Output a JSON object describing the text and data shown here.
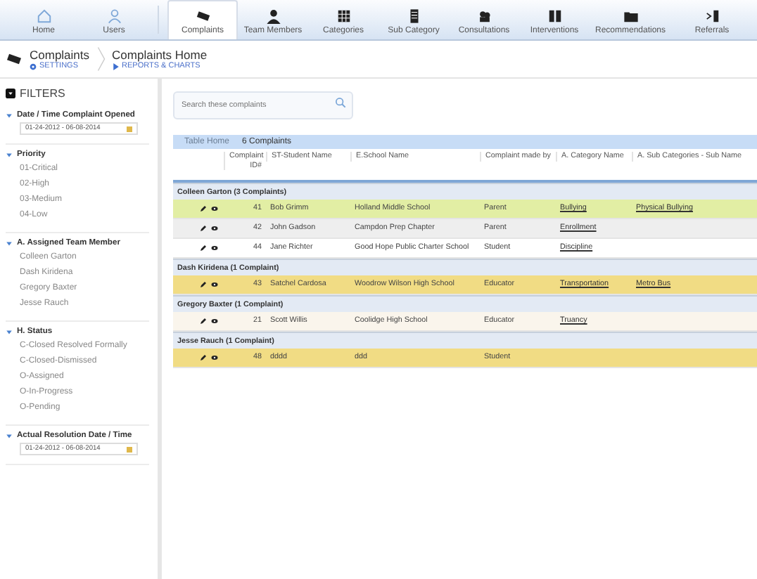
{
  "nav": [
    {
      "label": "Home",
      "selected": false
    },
    {
      "label": "Users",
      "selected": false
    },
    {
      "label": "Complaints",
      "selected": true
    },
    {
      "label": "Team Members",
      "selected": false
    },
    {
      "label": "Categories",
      "selected": false
    },
    {
      "label": "Sub Category",
      "selected": false
    },
    {
      "label": "Consultations",
      "selected": false
    },
    {
      "label": "Interventions",
      "selected": false
    },
    {
      "label": "Recommendations",
      "selected": false
    },
    {
      "label": "Referrals",
      "selected": false
    }
  ],
  "header": {
    "title": "Complaints",
    "settings": "SETTINGS",
    "page_title": "Complaints Home",
    "reports": "REPORTS & CHARTS"
  },
  "filters": {
    "title": "FILTERS",
    "sections": [
      {
        "kind": "date",
        "title": "Date / Time Complaint Opened",
        "value": "01-24-2012 - 06-08-2014"
      },
      {
        "kind": "list",
        "title": "Priority",
        "items": [
          "01-Critical",
          "02-High",
          "03-Medium",
          "04-Low"
        ]
      },
      {
        "kind": "list",
        "title": "A. Assigned Team Member",
        "items": [
          "Colleen Garton",
          "Dash Kiridena",
          "Gregory Baxter",
          "Jesse Rauch"
        ]
      },
      {
        "kind": "list",
        "title": "H. Status",
        "items": [
          "C-Closed Resolved Formally",
          "C-Closed-Dismissed",
          "O-Assigned",
          "O-In-Progress",
          "O-Pending"
        ]
      },
      {
        "kind": "date",
        "title": "Actual Resolution Date / Time",
        "value": "01-24-2012 - 06-08-2014"
      }
    ]
  },
  "search": {
    "placeholder": "Search these complaints"
  },
  "table": {
    "home": "Table Home",
    "count": "6 Complaints",
    "columns": [
      "Complaint ID#",
      "ST-Student Name",
      "E.School Name",
      "Complaint made by",
      "A. Category Name",
      "A. Sub Categories - Sub Name"
    ],
    "groups": [
      {
        "title": "Colleen Garton  (3 Complaints)",
        "rows": [
          {
            "color": "#e2eea4",
            "cells": [
              "41",
              "Bob Grimm",
              "Holland Middle School",
              "Parent",
              "Bullying",
              "Physical Bullying"
            ]
          },
          {
            "color": "#eeeeee",
            "cells": [
              "42",
              "John Gadson",
              "Campdon Prep Chapter",
              "Parent",
              "Enrollment",
              ""
            ]
          },
          {
            "color": "#ffffff",
            "cells": [
              "44",
              "Jane Richter",
              "Good Hope Public Charter School",
              "Student",
              "Discipline",
              ""
            ]
          }
        ]
      },
      {
        "title": "Dash Kiridena  (1 Complaint)",
        "rows": [
          {
            "color": "#f1dc84",
            "cells": [
              "43",
              "Satchel Cardosa",
              "Woodrow Wilson High School",
              "Educator",
              "Transportation",
              "Metro Bus"
            ]
          }
        ]
      },
      {
        "title": "Gregory Baxter  (1 Complaint)",
        "rows": [
          {
            "color": "#faf5ec",
            "cells": [
              "21",
              "Scott Willis",
              "Coolidge High School",
              "Educator",
              "Truancy",
              ""
            ]
          }
        ]
      },
      {
        "title": "Jesse Rauch  (1 Complaint)",
        "rows": [
          {
            "color": "#f1dc84",
            "cells": [
              "48",
              "dddd",
              "ddd",
              "Student",
              "",
              ""
            ]
          }
        ]
      }
    ]
  }
}
